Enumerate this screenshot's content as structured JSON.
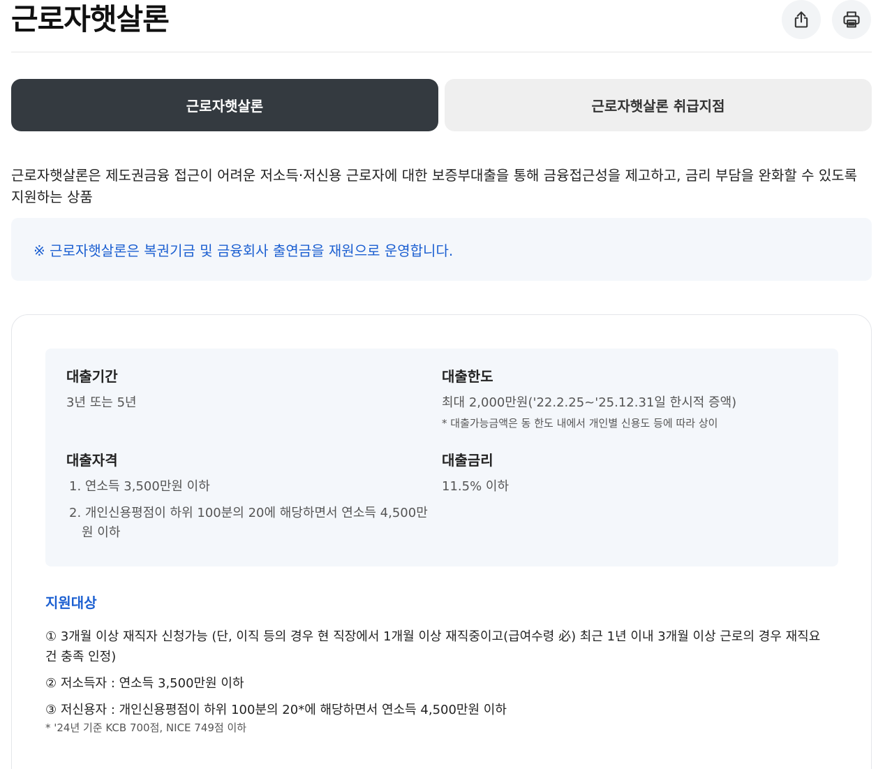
{
  "header": {
    "title": "근로자햇살론",
    "share_icon": "share-icon",
    "print_icon": "printer-icon"
  },
  "tabs": [
    {
      "label": "근로자햇살론",
      "active": true
    },
    {
      "label": "근로자햇살론 취급지점",
      "active": false
    }
  ],
  "description": "근로자햇살론은 제도권금융 접근이 어려운 저소득·저신용 근로자에 대한 보증부대출을 통해 금융접근성을 제고하고, 금리 부담을 완화할 수 있도록 지원하는 상품",
  "notice": "※ 근로자햇살론은 복권기금 및 금융회사 출연금을 재원으로 운영합니다.",
  "info": {
    "period": {
      "label": "대출기간",
      "value": "3년 또는 5년"
    },
    "limit": {
      "label": "대출한도",
      "value": "최대 2,000만원('22.2.25~'25.12.31일 한시적 증액)",
      "note": "* 대출가능금액은 동 한도 내에서 개인별 신용도 등에 따라 상이"
    },
    "eligibility": {
      "label": "대출자격",
      "items": [
        "1. 연소득 3,500만원 이하",
        "2. 개인신용평점이 하위 100분의 20에 해당하면서 연소득 4,500만원 이하"
      ]
    },
    "rate": {
      "label": "대출금리",
      "value": "11.5% 이하"
    }
  },
  "support": {
    "title": "지원대상",
    "items": [
      "① 3개월 이상 재직자 신청가능 (단, 이직 등의 경우 현 직장에서 1개월 이상 재직중이고(급여수령 必) 최근 1년 이내 3개월 이상 근로의 경우 재직요건 충족 인정)",
      "② 저소득자 : 연소득 3,500만원 이하",
      "③ 저신용자 : 개인신용평점이 하위 100분의 20*에 해당하면서 연소득 4,500만원 이하"
    ],
    "note": "* '24년 기준 KCB 700점, NICE 749점 이하"
  },
  "colors": {
    "accent": "#1b5fd1",
    "tab_active_bg": "#343a40",
    "tab_inactive_bg": "#efefef",
    "panel_bg": "#f4f7fb"
  }
}
